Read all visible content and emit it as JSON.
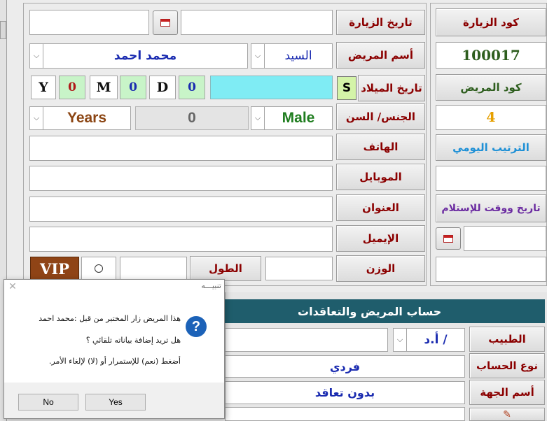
{
  "visit": {
    "visit_code_label": "كود الزيارة",
    "visit_code": "100017",
    "visit_date_label": "تاريخ الزيارة",
    "patient_code_label": "كود المريض",
    "daily_order_label": "الترتيب اليومي",
    "daily_order": "4",
    "receipt_label": "تاريخ ووقت للإستلام"
  },
  "patient": {
    "name_label": "أسم المريض",
    "title_value": "السيد",
    "name_value": "محمد احمد",
    "birthdate_label": "تاريخ الميلاد",
    "s_button": "S",
    "age": {
      "y_label": "Y",
      "y_value": "0",
      "m_label": "M",
      "m_value": "0",
      "d_label": "D",
      "d_value": "0"
    },
    "gender_age_label": "الجنس/ السن",
    "gender_value": "Male",
    "age_value": "0",
    "age_unit": "Years",
    "phone_label": "الهاتف",
    "mobile_label": "الموبايل",
    "address_label": "العنوان",
    "email_label": "الإيميل",
    "weight_label": "الوزن",
    "height_label": "الطول",
    "vip_label": "VIP"
  },
  "account": {
    "header": "حساب المريض والتعاقدات",
    "doctor_label": "الطبيب",
    "doctor_value": "أ.د /",
    "account_type_label": "نوع الحساب",
    "account_type_value": "فردي",
    "entity_label": "أسم الجهة",
    "entity_value": "بدون تعاقد"
  },
  "dialog": {
    "title": "تنبيـــه",
    "line1": "هذا المريض زار المختبر من قبل  :محمد احمد",
    "line2": "هل تريد إضافة بياناته تلقائي ؟",
    "line3": "أضغط (نعم) للإستمرار أو (لا) لإلغاء الأمر.",
    "no_label": "No",
    "yes_label": "Yes",
    "icon": "question-icon",
    "close_icon": "close-icon"
  },
  "colors": {
    "label_red": "#8b0000",
    "green_label": "#2e5e1e",
    "purple": "#6a2aa0",
    "blue_label": "#1e90d6",
    "header_teal": "#1f5d6c",
    "vip_bg": "#8f4416",
    "cyan_field": "#7fecf4",
    "male_green": "#1f7d1f",
    "years_brown": "#8b4513",
    "orange_num": "#e6a000"
  }
}
